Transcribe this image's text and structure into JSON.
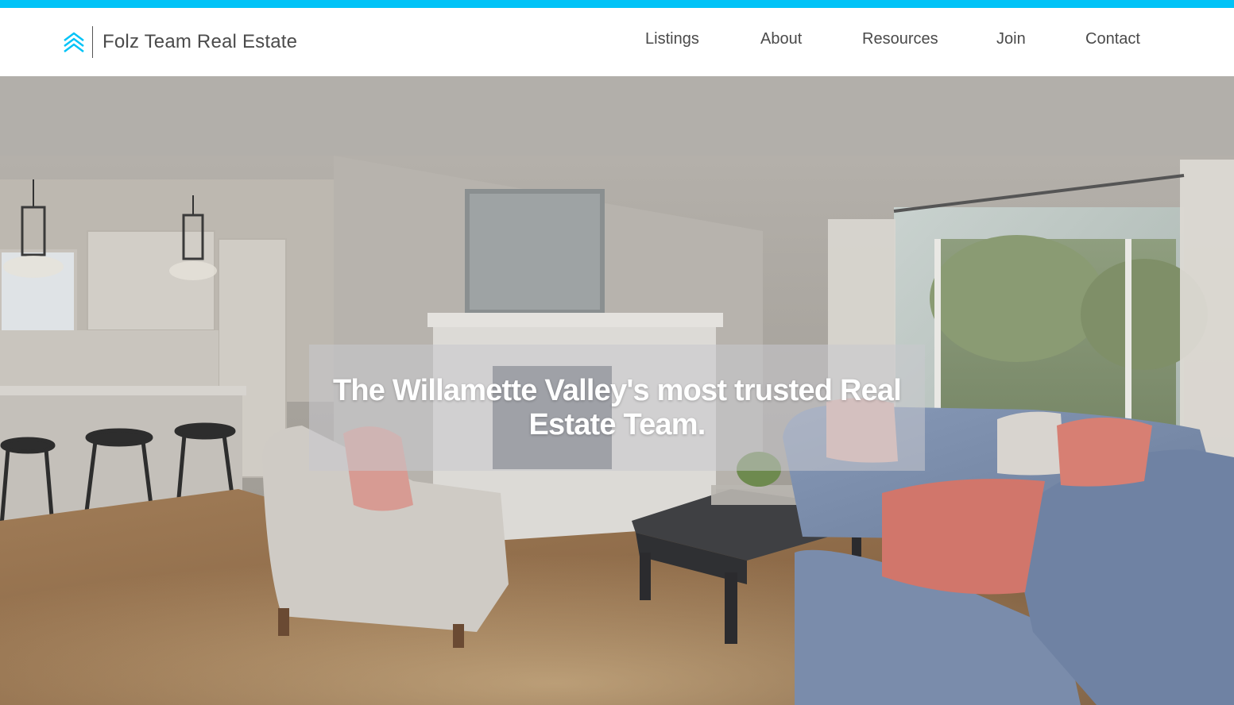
{
  "site": {
    "brand_name": "Folz Team Real Estate",
    "logo_icon": "chevrons-up-icon",
    "accent_color": "#00c3f7"
  },
  "nav": {
    "items": [
      {
        "label": "Listings"
      },
      {
        "label": "About"
      },
      {
        "label": "Resources"
      },
      {
        "label": "Join"
      },
      {
        "label": "Contact"
      }
    ]
  },
  "hero": {
    "tagline": "The Willamette Valley's most trusted Real Estate Team.",
    "background": "living-room-photo"
  }
}
